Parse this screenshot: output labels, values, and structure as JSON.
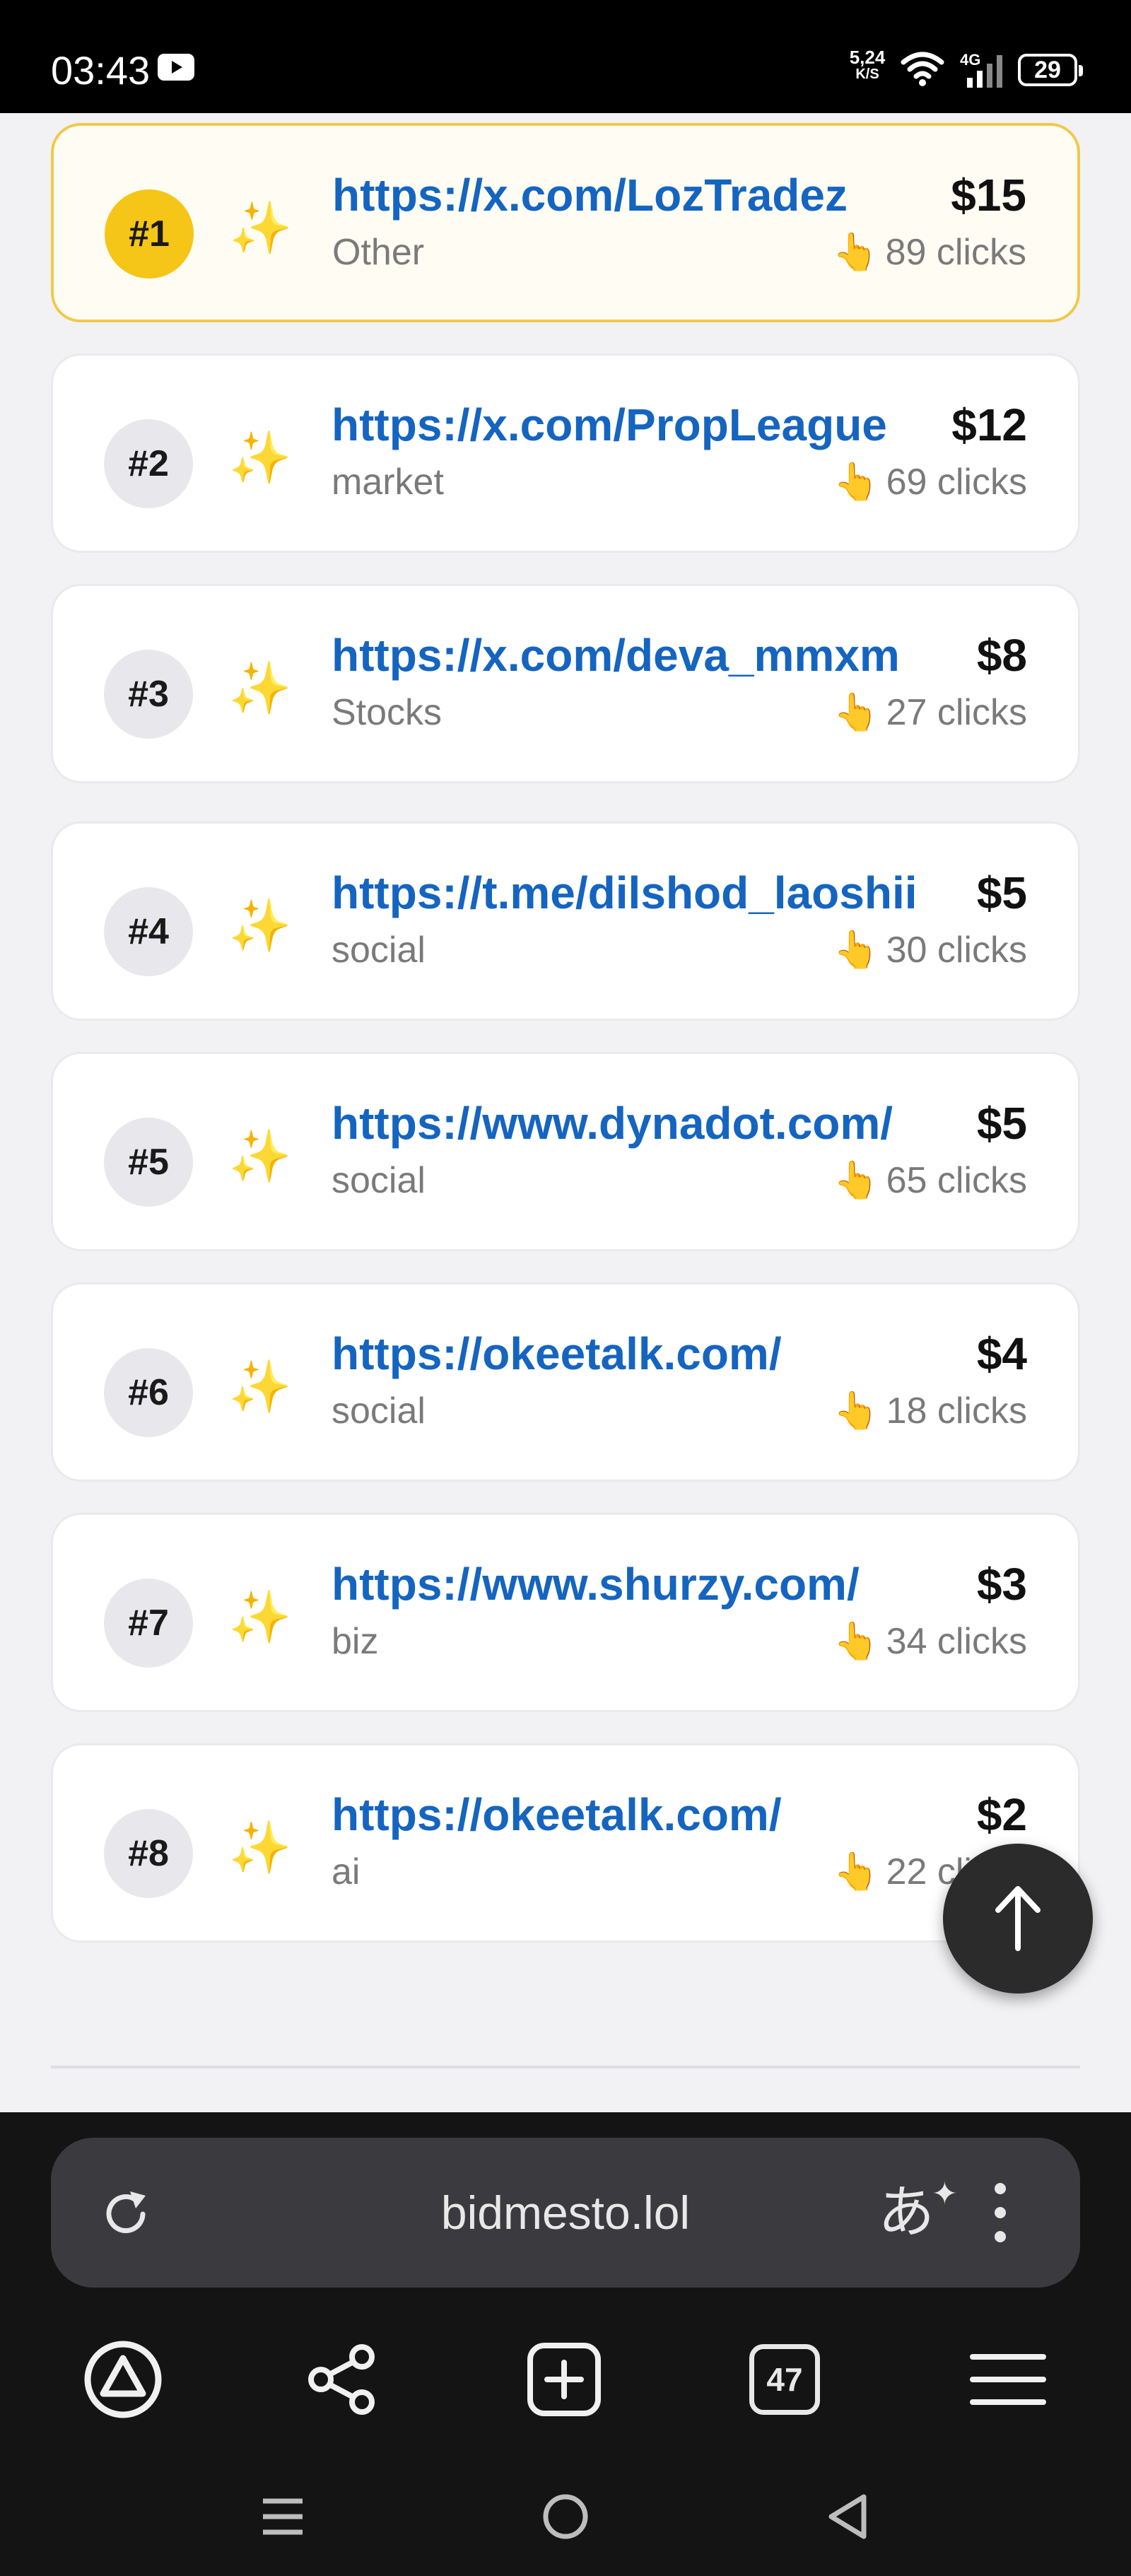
{
  "status_bar": {
    "time": "03:43",
    "net_speed_value": "5,24",
    "net_speed_unit": "K/S",
    "network_type": "4G",
    "battery": "29"
  },
  "listings": [
    {
      "rank": "#1",
      "emoji": "✨",
      "url": "https://x.com/LozTradez",
      "category": "Other",
      "price": "$15",
      "clicks": "89 clicks"
    },
    {
      "rank": "#2",
      "emoji": "✨",
      "url": "https://x.com/PropLeague",
      "category": "market",
      "price": "$12",
      "clicks": "69 clicks"
    },
    {
      "rank": "#3",
      "emoji": "✨",
      "url": "https://x.com/deva_mmxm",
      "category": "Stocks",
      "price": "$8",
      "clicks": "27 clicks"
    },
    {
      "rank": "#4",
      "emoji": "✨",
      "url": "https://t.me/dilshod_laoshii",
      "category": "social",
      "price": "$5",
      "clicks": "30 clicks"
    },
    {
      "rank": "#5",
      "emoji": "✨",
      "url": "https://www.dynadot.com/",
      "category": "social",
      "price": "$5",
      "clicks": "65 clicks"
    },
    {
      "rank": "#6",
      "emoji": "✨",
      "url": "https://okeetalk.com/",
      "category": "social",
      "price": "$4",
      "clicks": "18 clicks"
    },
    {
      "rank": "#7",
      "emoji": "✨",
      "url": "https://www.shurzy.com/",
      "category": "biz",
      "price": "$3",
      "clicks": "34 clicks"
    },
    {
      "rank": "#8",
      "emoji": "✨",
      "url": "https://okeetalk.com/",
      "category": "ai",
      "price": "$2",
      "clicks": "22 clicks"
    }
  ],
  "click_icon": "👆",
  "browser": {
    "url": "bidmesto.lol",
    "translate_glyph": "あ",
    "tab_count": "47"
  },
  "colors": {
    "link": "#1565c0",
    "top_rank_badge": "#f5c518",
    "top_card_border": "#f0c94a"
  }
}
